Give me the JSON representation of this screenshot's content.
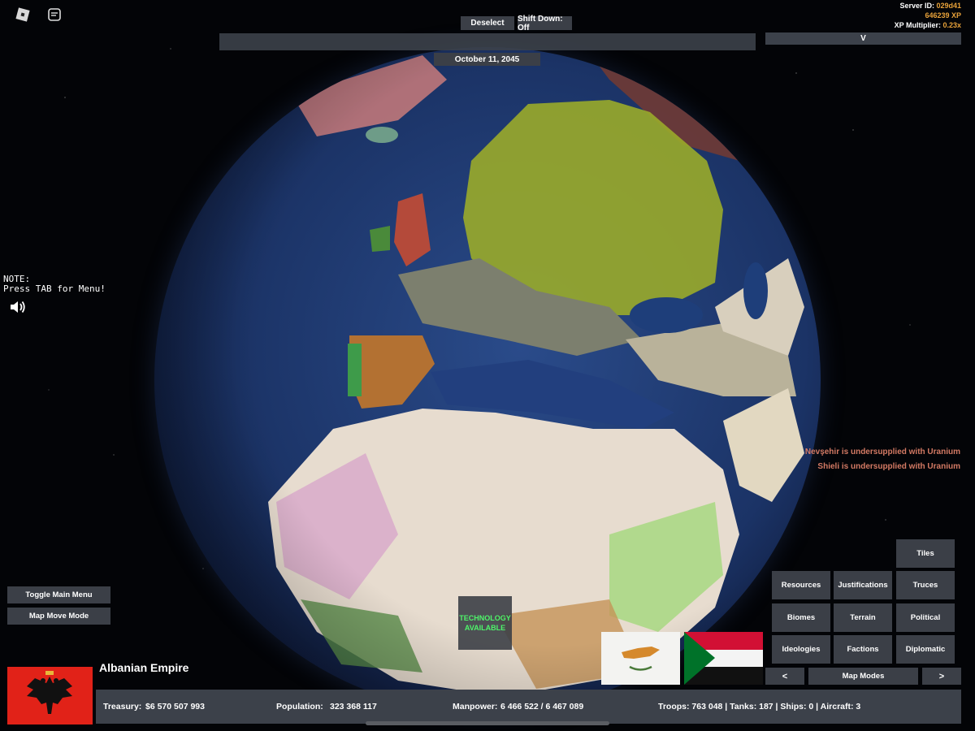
{
  "top": {
    "deselect_label": "Deselect",
    "shift_label": "Shift Down: Off",
    "v_label": "V",
    "date": "October 11, 2045"
  },
  "server": {
    "id_prefix": "Server ID: ",
    "id_value": "029d41",
    "xp": "646239 XP",
    "multiplier_prefix": "XP Multiplier: ",
    "multiplier_value": "0.23x"
  },
  "note": {
    "line1": "NOTE:",
    "line2": "Press TAB for Menu!"
  },
  "notifications": [
    "Nevşehir is undersupplied with Uranium",
    "Shieli is undersupplied with Uranium"
  ],
  "left_menu": {
    "toggle_main_menu": "Toggle Main Menu",
    "map_move_mode": "Map Move Mode"
  },
  "tech": {
    "line1": "TECHNOLOGY",
    "line2": "AVAILABLE"
  },
  "map_modes": {
    "tiles": "Tiles",
    "resources": "Resources",
    "justifications": "Justifications",
    "truces": "Truces",
    "biomes": "Biomes",
    "terrain": "Terrain",
    "political": "Political",
    "ideologies": "Ideologies",
    "factions": "Factions",
    "diplomatic": "Diplomatic",
    "prev": "<",
    "label": "Map Modes",
    "next": ">"
  },
  "country": {
    "name": "Albanian Empire",
    "treasury_label": "Treasury:",
    "treasury": "$6 570 507 993",
    "population_label": "Population:",
    "population": "323 368 117",
    "manpower_label": "Manpower:",
    "manpower": "6 466 522  /  6 467 089",
    "troops": "Troops: 763 048  |  Tanks: 187  |  Ships: 0  |  Aircraft: 3"
  },
  "colors": {
    "accent": "#e8a23a",
    "notification": "#d47a64",
    "tech_text": "#4ef46a",
    "panel": "#3c414a"
  }
}
